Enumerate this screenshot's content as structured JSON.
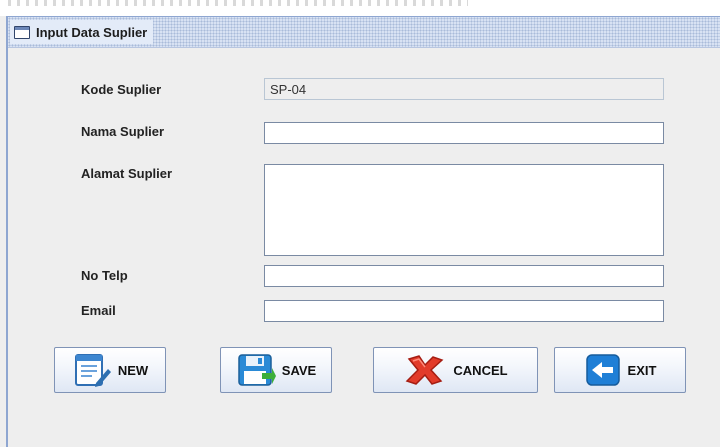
{
  "window": {
    "title": "Input Data Suplier"
  },
  "form": {
    "kode_label": "Kode Suplier",
    "kode_value": "SP-04",
    "nama_label": "Nama Suplier",
    "nama_value": "",
    "alamat_label": "Alamat Suplier",
    "alamat_value": "",
    "telp_label": "No Telp",
    "telp_value": "",
    "email_label": "Email",
    "email_value": ""
  },
  "buttons": {
    "new_label": "NEW",
    "save_label": "SAVE",
    "cancel_label": "CANCEL",
    "exit_label": "EXIT"
  },
  "icons": {
    "window": "window-icon",
    "new": "notepad-new-icon",
    "save": "floppy-save-icon",
    "cancel": "red-x-cancel-icon",
    "exit": "blue-arrow-exit-icon"
  },
  "colors": {
    "frame_border": "#8ea6d1",
    "titlebar": "#d8e2f3",
    "cancel_red": "#e23b2a",
    "exit_blue": "#1f7fd6",
    "save_blue": "#2a8ad6"
  }
}
